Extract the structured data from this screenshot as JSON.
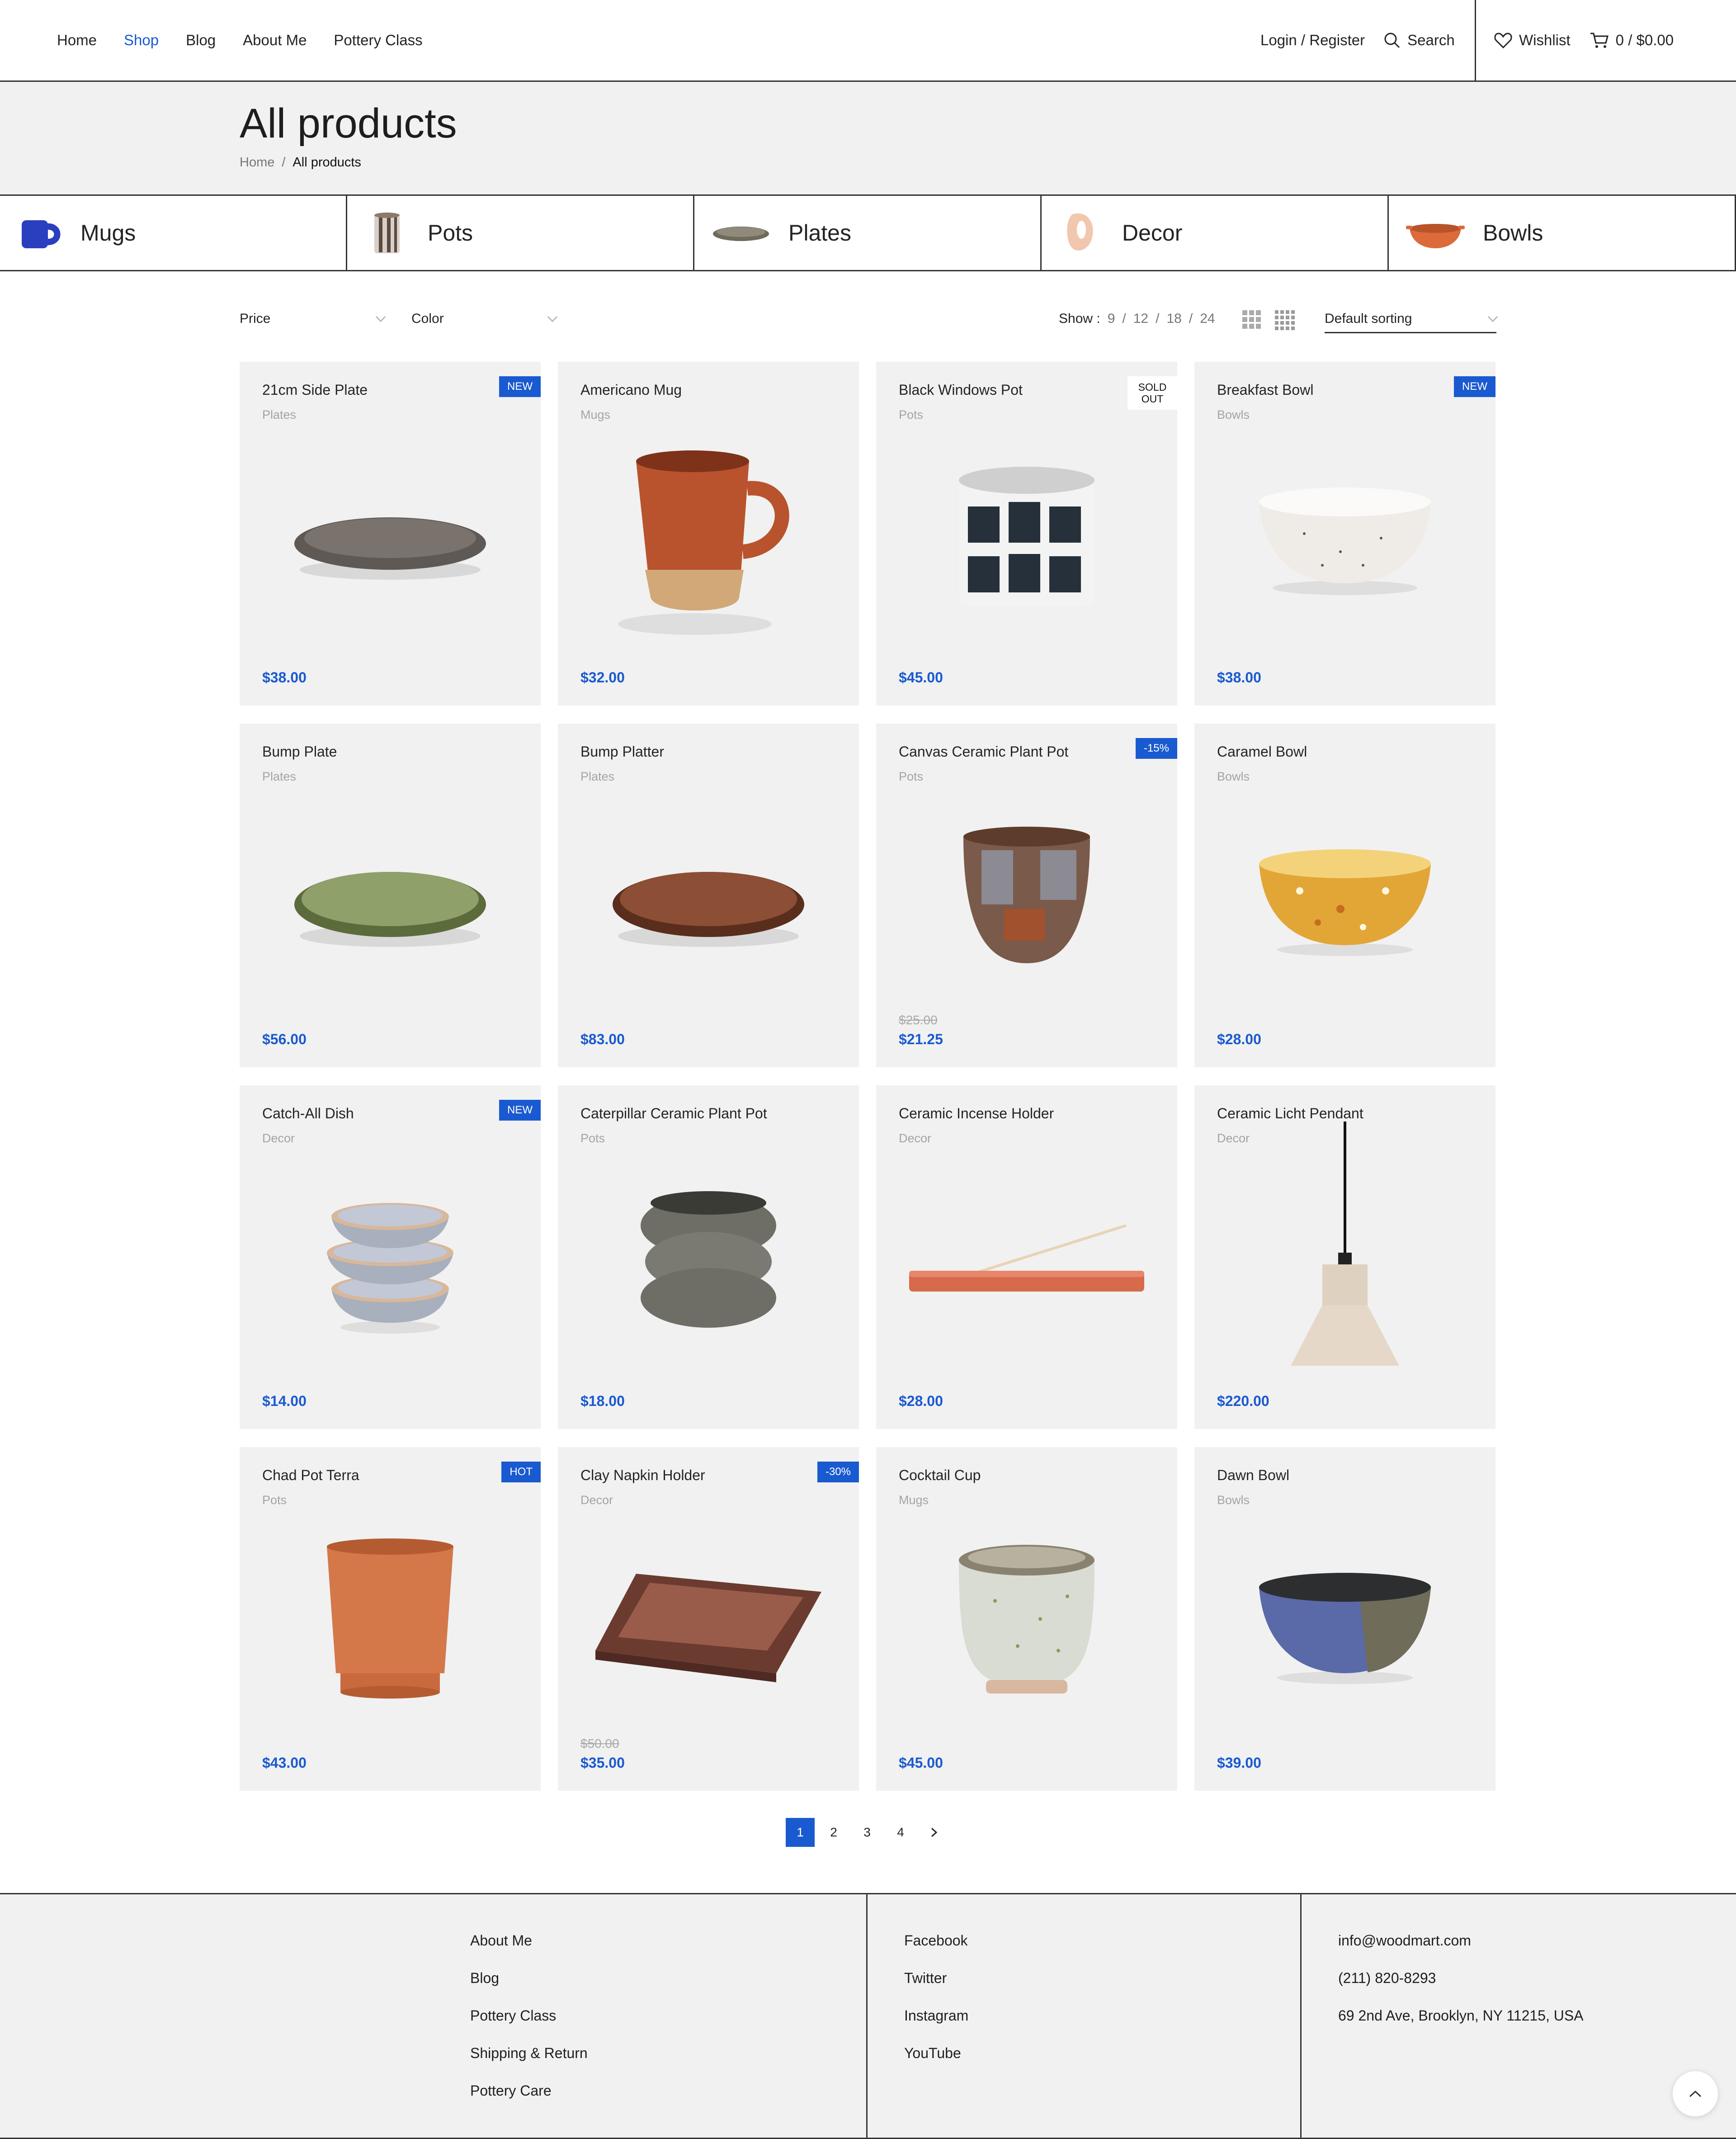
{
  "nav": {
    "items": [
      {
        "label": "Home",
        "active": false
      },
      {
        "label": "Shop",
        "active": true
      },
      {
        "label": "Blog",
        "active": false
      },
      {
        "label": "About Me",
        "active": false
      },
      {
        "label": "Pottery Class",
        "active": false
      }
    ],
    "login": "Login / Register",
    "search": "Search",
    "wishlist": "Wishlist",
    "cart": "0 / $0.00"
  },
  "page": {
    "title": "All products",
    "breadcrumb_home": "Home",
    "breadcrumb_sep": "/",
    "breadcrumb_current": "All products"
  },
  "categories": [
    {
      "label": "Mugs",
      "icon": "mug-icon"
    },
    {
      "label": "Pots",
      "icon": "pot-icon"
    },
    {
      "label": "Plates",
      "icon": "plate-icon"
    },
    {
      "label": "Decor",
      "icon": "decor-icon"
    },
    {
      "label": "Bowls",
      "icon": "bowl-icon"
    }
  ],
  "filters": {
    "price": "Price",
    "color": "Color",
    "show_label": "Show :",
    "show_options": [
      "9",
      "12",
      "18",
      "24"
    ],
    "show_sep": "/",
    "sorting": "Default sorting"
  },
  "products": [
    {
      "name": "21cm Side Plate",
      "category": "Plates",
      "price": "$38.00",
      "old_price": "",
      "badge": "NEW",
      "art": "plate-dark"
    },
    {
      "name": "Americano Mug",
      "category": "Mugs",
      "price": "$32.00",
      "old_price": "",
      "badge": "",
      "art": "mug"
    },
    {
      "name": "Black Windows Pot",
      "category": "Pots",
      "price": "$45.00",
      "old_price": "",
      "badge": "SOLD OUT",
      "art": "window-pot"
    },
    {
      "name": "Breakfast Bowl",
      "category": "Bowls",
      "price": "$38.00",
      "old_price": "",
      "badge": "NEW",
      "art": "white-bowl"
    },
    {
      "name": "Bump Plate",
      "category": "Plates",
      "price": "$56.00",
      "old_price": "",
      "badge": "",
      "art": "plate-green"
    },
    {
      "name": "Bump Platter",
      "category": "Plates",
      "price": "$83.00",
      "old_price": "",
      "badge": "",
      "art": "plate-brown"
    },
    {
      "name": "Canvas Ceramic Plant Pot",
      "category": "Pots",
      "price": "$21.25",
      "old_price": "$25.00",
      "badge": "-15%",
      "art": "canvas-pot"
    },
    {
      "name": "Caramel Bowl",
      "category": "Bowls",
      "price": "$28.00",
      "old_price": "",
      "badge": "",
      "art": "caramel-bowl"
    },
    {
      "name": "Catch-All Dish",
      "category": "Decor",
      "price": "$14.00",
      "old_price": "",
      "badge": "NEW",
      "art": "stacked-dishes"
    },
    {
      "name": "Caterpillar Ceramic Plant Pot",
      "category": "Pots",
      "price": "$18.00",
      "old_price": "",
      "badge": "",
      "art": "caterpillar-pot"
    },
    {
      "name": "Ceramic Incense Holder",
      "category": "Decor",
      "price": "$28.00",
      "old_price": "",
      "badge": "",
      "art": "incense"
    },
    {
      "name": "Ceramic Licht Pendant",
      "category": "Decor",
      "price": "$220.00",
      "old_price": "",
      "badge": "",
      "art": "pendant"
    },
    {
      "name": "Chad Pot Terra",
      "category": "Pots",
      "price": "$43.00",
      "old_price": "",
      "badge": "HOT",
      "art": "terra-pot"
    },
    {
      "name": "Clay Napkin Holder",
      "category": "Decor",
      "price": "$35.00",
      "old_price": "$50.00",
      "badge": "-30%",
      "art": "napkin-tray"
    },
    {
      "name": "Cocktail Cup",
      "category": "Mugs",
      "price": "$45.00",
      "old_price": "",
      "badge": "",
      "art": "cocktail-cup"
    },
    {
      "name": "Dawn Bowl",
      "category": "Bowls",
      "price": "$39.00",
      "old_price": "",
      "badge": "",
      "art": "dawn-bowl"
    }
  ],
  "pagination": [
    "1",
    "2",
    "3",
    "4"
  ],
  "footer": {
    "col1": [
      "About Me",
      "Blog",
      "Pottery Class",
      "Shipping & Return",
      "Pottery Care"
    ],
    "col2": [
      "Facebook",
      "Twitter",
      "Instagram",
      "YouTube"
    ],
    "col3": [
      "info@woodmart.com",
      "(211) 820-8293",
      "69 2nd Ave, Brooklyn, NY 11215, USA"
    ]
  },
  "colors": {
    "accent": "#1a5ad0",
    "band": "#f1f1f1",
    "border": "#333333"
  }
}
